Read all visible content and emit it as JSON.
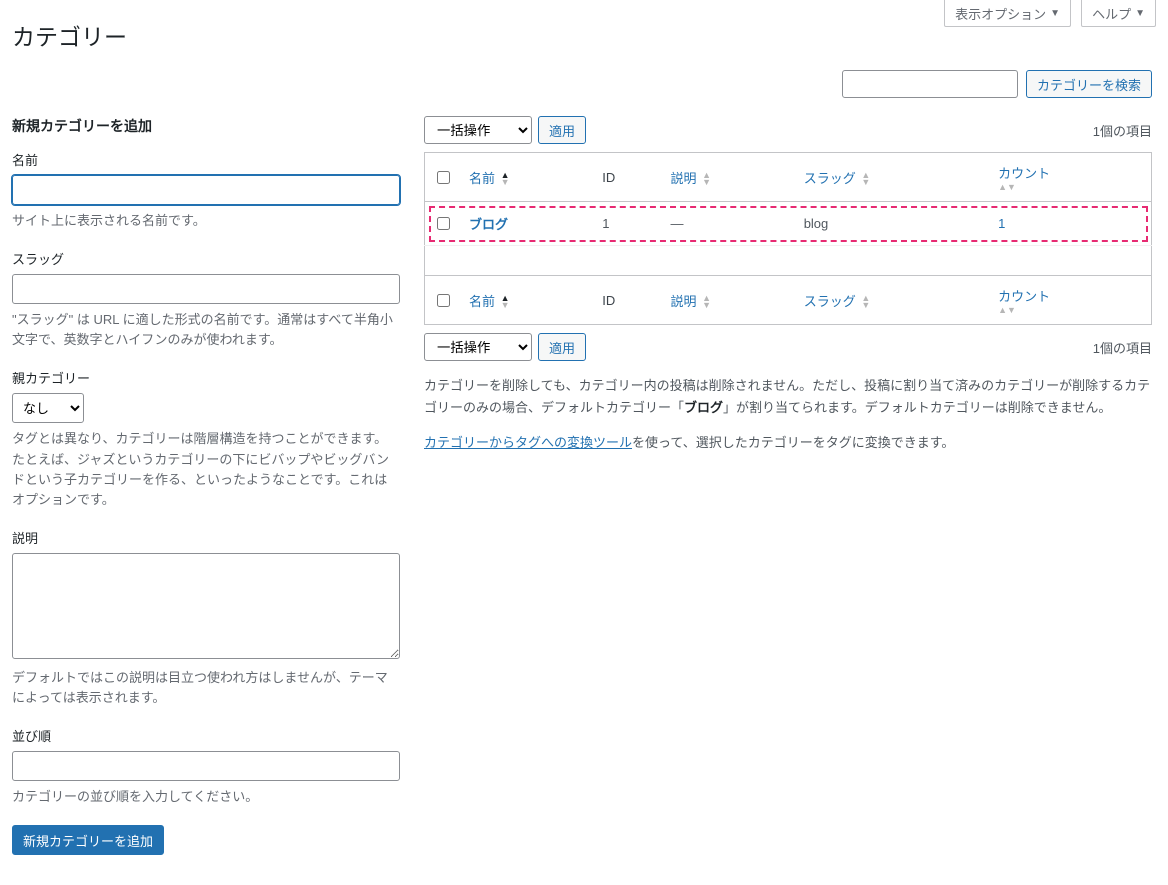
{
  "top": {
    "screen_options": "表示オプション",
    "help": "ヘルプ"
  },
  "page": {
    "title": "カテゴリー"
  },
  "search": {
    "button": "カテゴリーを検索"
  },
  "form": {
    "section_title": "新規カテゴリーを追加",
    "name": {
      "label": "名前",
      "help": "サイト上に表示される名前です。"
    },
    "slug": {
      "label": "スラッグ",
      "help": "\"スラッグ\" は URL に適した形式の名前です。通常はすべて半角小文字で、英数字とハイフンのみが使われます。"
    },
    "parent": {
      "label": "親カテゴリー",
      "option_none": "なし",
      "help": "タグとは異なり、カテゴリーは階層構造を持つことができます。たとえば、ジャズというカテゴリーの下にビバップやビッグバンドという子カテゴリーを作る、といったようなことです。これはオプションです。"
    },
    "description": {
      "label": "説明",
      "help": "デフォルトではこの説明は目立つ使われ方はしませんが、テーマによっては表示されます。"
    },
    "order": {
      "label": "並び順",
      "help": "カテゴリーの並び順を入力してください。"
    },
    "submit": "新規カテゴリーを追加"
  },
  "list": {
    "bulk_placeholder": "一括操作",
    "apply": "適用",
    "item_count": "1個の項目",
    "cols": {
      "name": "名前",
      "id": "ID",
      "desc": "説明",
      "slug": "スラッグ",
      "count": "カウント"
    },
    "rows": [
      {
        "name": "ブログ",
        "id": "1",
        "desc": "—",
        "slug": "blog",
        "count": "1"
      }
    ]
  },
  "notes": {
    "p1a": "カテゴリーを削除しても、カテゴリー内の投稿は削除されません。ただし、投稿に割り当て済みのカテゴリーが削除するカテゴリーのみの場合、デフォルトカテゴリー「",
    "p1b": "ブログ",
    "p1c": "」が割り当てられます。デフォルトカテゴリーは削除できません。",
    "link": "カテゴリーからタグへの変換ツール",
    "p2": "を使って、選択したカテゴリーをタグに変換できます。"
  }
}
